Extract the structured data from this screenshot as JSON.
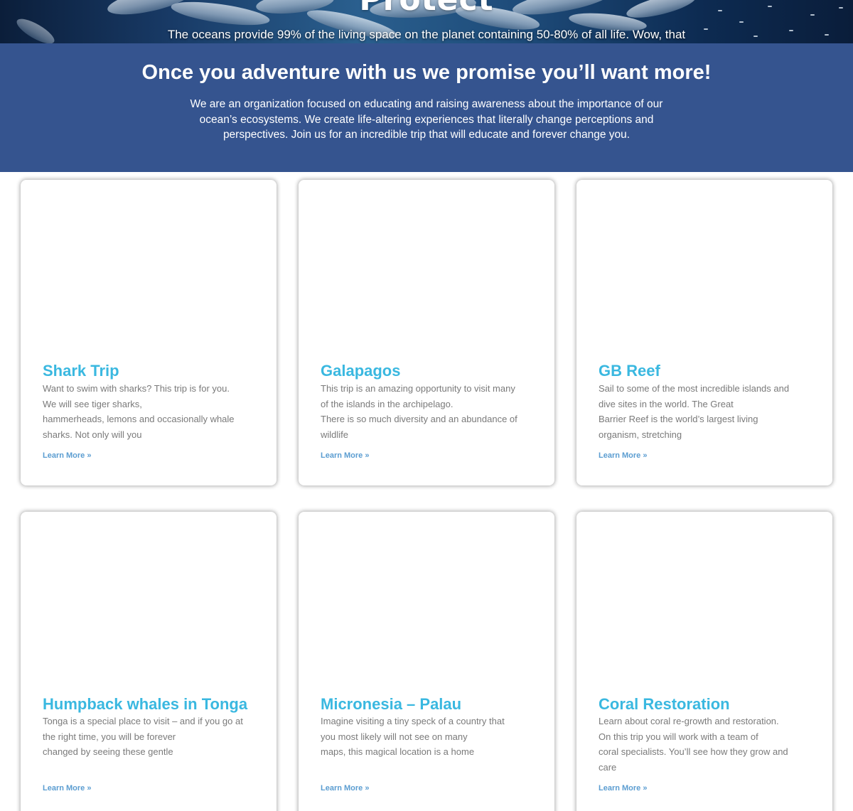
{
  "hero": {
    "title": "Protect",
    "subtitle": "The oceans provide 99% of the living space on the planet containing 50-80% of all life. Wow, that"
  },
  "band": {
    "title": "Once you adventure with us we promise you’ll want more!",
    "text": "We are an organization focused on educating and raising awareness about the importance of our ocean’s ecosystems. We create life-altering experiences that literally change perceptions and perspectives. Join us for an incredible trip that will educate and forever change you."
  },
  "cards": [
    {
      "title": "Shark Trip",
      "excerpt": "Want to swim with sharks? This trip is for you.\nWe will see tiger sharks,\nhammerheads, lemons and occasionally whale\nsharks. Not only will you",
      "link": "Learn More »"
    },
    {
      "title": "Galapagos",
      "excerpt": "This trip is an amazing opportunity to visit many\nof the islands in the archipelago.\nThere is so much diversity and an abundance of\nwildlife",
      "link": "Learn More »"
    },
    {
      "title": "GB Reef",
      "excerpt": "Sail to some of the most incredible islands and\ndive sites in the world. The Great\nBarrier Reef is the world’s largest living\norganism, stretching",
      "link": "Learn More »"
    },
    {
      "title": "Humpback whales in Tonga",
      "excerpt": "Tonga is a special place to visit – and if you go at\nthe right time, you will be forever\nchanged by seeing these gentle",
      "link": "Learn More »"
    },
    {
      "title": "Micronesia – Palau",
      "excerpt": "Imagine visiting a tiny speck of a country that\nyou most likely will not see on many\nmaps, this magical location is a home",
      "link": "Learn More »"
    },
    {
      "title": "Coral Restoration",
      "excerpt": "Learn about coral re-growth and restoration.\nOn this trip you will work with a team of\ncoral specialists. You’ll see how they grow and\ncare",
      "link": "Learn More »"
    }
  ],
  "colors": {
    "band": "#35548f",
    "card_title": "#3ab8e0",
    "link": "#5b9dd1",
    "excerpt": "#7a7a7a"
  }
}
